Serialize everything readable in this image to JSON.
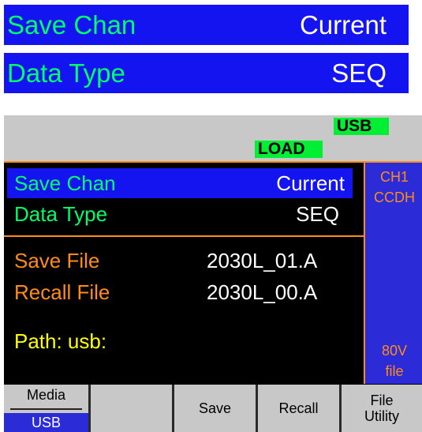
{
  "banners": [
    {
      "label": "Save Chan",
      "value": "Current"
    },
    {
      "label": "Data Type",
      "value": "SEQ"
    }
  ],
  "status": {
    "usb": "USB",
    "load": "LOAD"
  },
  "menu": {
    "save_chan": {
      "label": "Save Chan",
      "value": "Current"
    },
    "data_type": {
      "label": "Data Type",
      "value": "SEQ"
    }
  },
  "files": {
    "save_label": "Save File",
    "save_value": "2030L_01.A",
    "recall_label": "Recall File",
    "recall_value": "2030L_00.A",
    "path_label": "Path:  usb:"
  },
  "side": {
    "channel": "CH1",
    "mode": "CCDH",
    "voltage": "80V",
    "file_label": "file"
  },
  "softkeys": {
    "media_top": "Media",
    "media_bottom": "USB",
    "save": "Save",
    "recall": "Recall",
    "file_utility_line1": "File",
    "file_utility_line2": "Utility"
  },
  "colors": {
    "banner_bg": "#1414f0",
    "label_green": "#00ff66",
    "orange": "#ff8c1a",
    "path_yellow": "#ffff00",
    "side_blue": "#2b2bd8"
  }
}
